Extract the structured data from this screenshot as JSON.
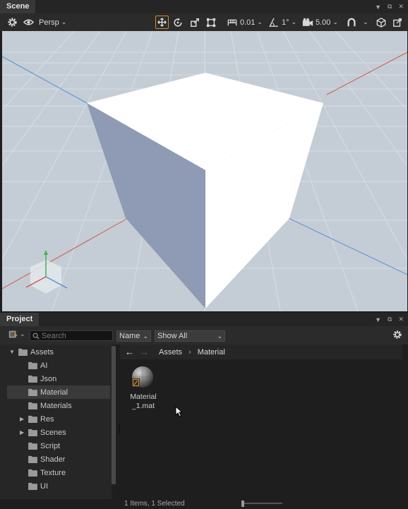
{
  "scene_panel": {
    "title": "Scene",
    "menu_icon": "dropdown-triangle",
    "restore_icon": "restore",
    "close_icon": "close",
    "toolbar": {
      "camera_mode": "Persp",
      "snap_move": "0.01",
      "snap_rotate": "1°",
      "camera_speed": "5.00"
    }
  },
  "project_panel": {
    "title": "Project",
    "search_placeholder": "Search",
    "sort_label": "Name",
    "filter_label": "Show All",
    "tree": [
      {
        "label": "Assets",
        "expanded": true
      },
      {
        "label": "AI"
      },
      {
        "label": "Json"
      },
      {
        "label": "Material",
        "selected": true
      },
      {
        "label": "Materials"
      },
      {
        "label": "Res",
        "collapsed": true
      },
      {
        "label": "Scenes",
        "collapsed": true
      },
      {
        "label": "Script"
      },
      {
        "label": "Shader"
      },
      {
        "label": "Texture"
      },
      {
        "label": "UI"
      }
    ],
    "breadcrumb": [
      "Assets",
      "Material"
    ],
    "breadcrumb_separator": "›",
    "assets": [
      {
        "name_line1": "Material",
        "name_line2": "_1.mat",
        "icon": "material-sphere-icon"
      }
    ],
    "status": "1 Items, 1 Selected"
  },
  "colors": {
    "accent": "#d08a2e",
    "sky": "#c9d2d9",
    "ground": "#bcc6ce",
    "cube_left_face": "#8f9ab4",
    "x_axis": "#d2584a",
    "z_axis": "#5a8fd6",
    "y_axis": "#43b05a"
  }
}
